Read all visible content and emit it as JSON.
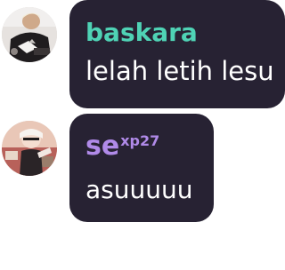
{
  "messages": [
    {
      "username": "baskara",
      "username_color": "#4fd3b5",
      "text": "lelah letih lesu",
      "avatar_icon": "user-avatar-photo"
    },
    {
      "username": "se",
      "username_suffix": "xp27",
      "username_color": "#b08ae8",
      "text": "asuuuuu",
      "avatar_icon": "user-avatar-photo"
    }
  ],
  "colors": {
    "bubble_bg": "#272233",
    "text": "#ffffff",
    "page_bg": "#ffffff"
  }
}
